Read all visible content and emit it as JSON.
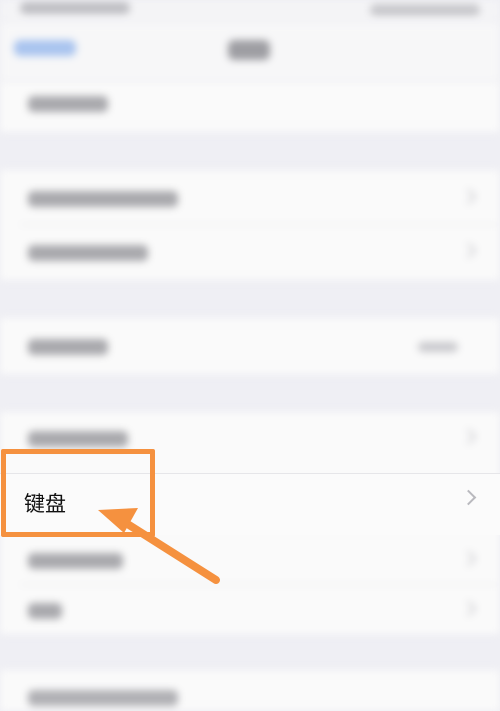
{
  "settings": {
    "keyboard_row": {
      "label": "键盘",
      "chevron_icon": "chevron-right-icon"
    }
  },
  "annotation": {
    "highlight_color": "#f5913f",
    "arrow_icon": "arrow-pointer-icon"
  }
}
